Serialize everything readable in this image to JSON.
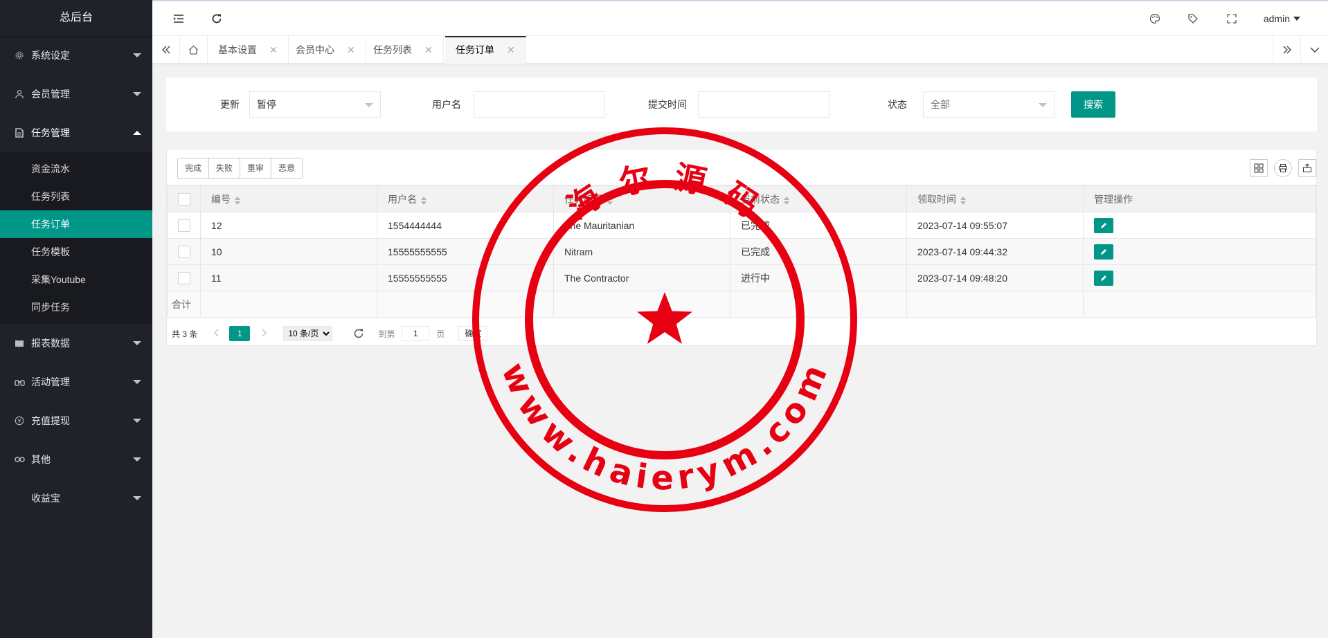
{
  "app": {
    "title": "总后台"
  },
  "sidebar": {
    "groups": [
      {
        "label": "系统设定",
        "icon": "gear-icon"
      },
      {
        "label": "会员管理",
        "icon": "user-icon"
      },
      {
        "label": "任务管理",
        "icon": "file-icon"
      },
      {
        "label": "报表数据",
        "icon": "report-icon"
      },
      {
        "label": "活动管理",
        "icon": "binoculars-icon"
      },
      {
        "label": "充值提现",
        "icon": "yen-icon"
      },
      {
        "label": "其他",
        "icon": "link-icon"
      },
      {
        "label": "收益宝",
        "icon": ""
      }
    ],
    "task_subitems": [
      "资金流水",
      "任务列表",
      "任务订单",
      "任务模板",
      "采集Youtube",
      "同步任务"
    ]
  },
  "header": {
    "user": "admin"
  },
  "tabs": [
    {
      "label": "基本设置"
    },
    {
      "label": "会员中心"
    },
    {
      "label": "任务列表"
    },
    {
      "label": "任务订单"
    }
  ],
  "filters": {
    "update_label": "更新",
    "update_value": "暂停",
    "username_label": "用户名",
    "submit_time_label": "提交时间",
    "status_label": "状态",
    "status_value": "全部",
    "search_button": "搜索"
  },
  "toolbar": {
    "buttons": [
      "完成",
      "失败",
      "重审",
      "恶意"
    ]
  },
  "table": {
    "columns": [
      "编号",
      "用户名",
      "任务标题",
      "当前状态",
      "领取时间",
      "管理操作"
    ],
    "rows": [
      {
        "id": "12",
        "username": "1554444444",
        "title": "The Mauritanian",
        "status": "已完成",
        "time": "2023-07-14 09:55:07"
      },
      {
        "id": "10",
        "username": "15555555555",
        "title": "Nitram",
        "status": "已完成",
        "time": "2023-07-14 09:44:32"
      },
      {
        "id": "11",
        "username": "15555555555",
        "title": "The Contractor",
        "status": "进行中",
        "time": "2023-07-14 09:48:20"
      }
    ],
    "total_label": "合计"
  },
  "pager": {
    "count": "共 3 条",
    "current_page": "1",
    "page_size": "10 条/页",
    "page_size_options": [
      "10 条/页"
    ],
    "goto_label": "到第",
    "goto_value": "1",
    "page_suffix": "页",
    "confirm": "确定"
  },
  "watermark": {
    "top_text": "海 尔 源 码",
    "bottom_text": "www.haierym.com",
    "color": "#e60012"
  }
}
